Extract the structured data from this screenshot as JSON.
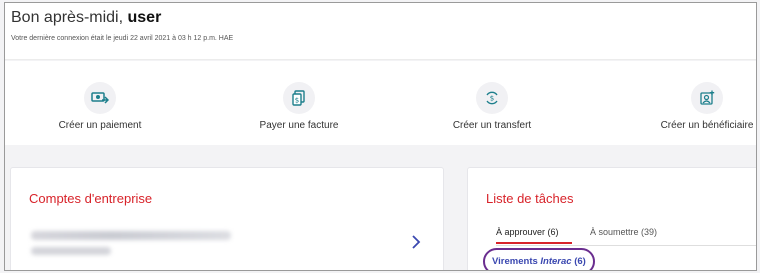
{
  "greeting": {
    "prefix": "Bon après-midi,",
    "user": "user",
    "last_login": "Votre dernière connexion était le jeudi 22 avril 2021 à 03 h 12 p.m. HAE"
  },
  "actions": [
    {
      "label": "Créer un paiement",
      "icon": "payment-icon"
    },
    {
      "label": "Payer une facture",
      "icon": "bill-icon"
    },
    {
      "label": "Créer un transfert",
      "icon": "transfer-icon"
    },
    {
      "label": "Créer un bénéficiaire",
      "icon": "add-payee-icon"
    }
  ],
  "accounts": {
    "title": "Comptes d'entreprise"
  },
  "tasks": {
    "title": "Liste de tâches",
    "tabs": [
      {
        "label": "À approuver (6)",
        "active": true
      },
      {
        "label": "À soumettre (39)",
        "active": false
      }
    ],
    "item": {
      "prefix": "Virements ",
      "brand": "Interac",
      "count": " (6)"
    }
  },
  "colors": {
    "accent_red": "#d8232a",
    "icon_teal": "#1d7f8c",
    "highlight_purple": "#6a2d8f",
    "link_blue": "#3b48b0"
  }
}
